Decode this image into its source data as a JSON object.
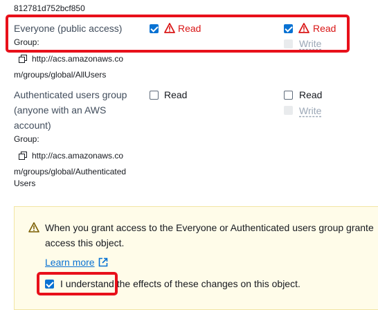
{
  "owner_id_tail": "812781d752bcf850",
  "rows": [
    {
      "grantee_lines": [
        "Everyone (public access)"
      ],
      "group_label": "Group:",
      "uri_lines": [
        "http://acs.amazonaws.co",
        "m/groups/global/AllUsers"
      ],
      "object": {
        "read_label": "Read",
        "read_checked": true,
        "public_warning": true
      },
      "object_acl": {
        "read_label": "Read",
        "read_checked": true,
        "public_warning": true,
        "write_label": "Write",
        "write_disabled": true
      }
    },
    {
      "grantee_lines": [
        "Authenticated users group",
        "(anyone with an AWS",
        "account)"
      ],
      "group_label": "Group:",
      "uri_lines": [
        "http://acs.amazonaws.co",
        "m/groups/global/Authenticated",
        "Users"
      ],
      "object": {
        "read_label": "Read",
        "read_checked": false
      },
      "object_acl": {
        "read_label": "Read",
        "read_checked": false,
        "write_label": "Write",
        "write_disabled": true
      }
    }
  ],
  "warning": {
    "line1": "When you grant access to the Everyone or Authenticated users group grante",
    "line2": "access this object.",
    "learn_more": "Learn more",
    "ack_checked": true,
    "ack_label": "I understand",
    "ack_rest": " the effects of these changes on this object."
  },
  "colors": {
    "highlight": "#e8101a",
    "accent": "#0972d3",
    "warning_red": "#d91515"
  }
}
